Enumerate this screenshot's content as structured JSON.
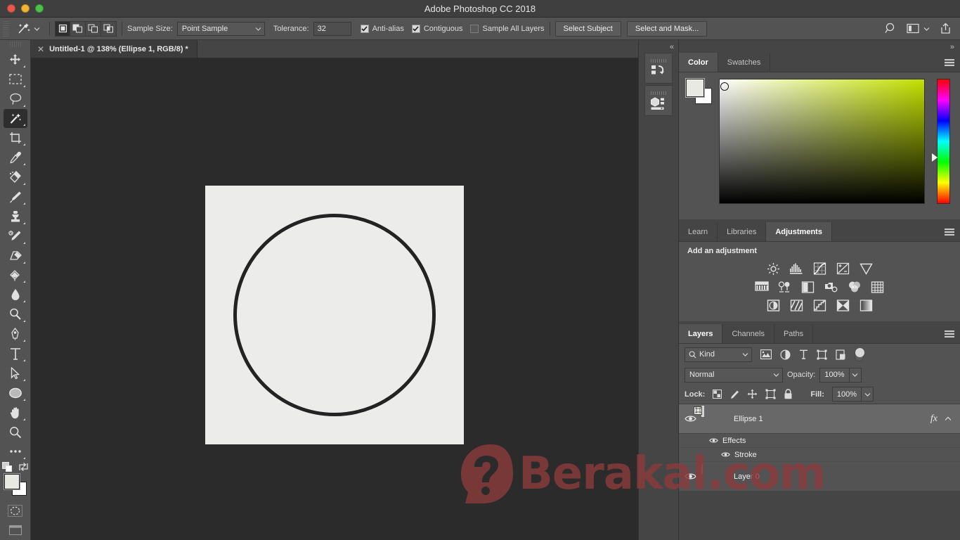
{
  "window": {
    "title": "Adobe Photoshop CC 2018",
    "controls": [
      "close",
      "minimize",
      "maximize"
    ]
  },
  "options_bar": {
    "tool_icon": "magic-wand-icon",
    "tool_preset_chevron": "chevron-down-icon",
    "selection_modes": [
      {
        "name": "new-selection",
        "active": true
      },
      {
        "name": "add-to-selection",
        "active": false
      },
      {
        "name": "subtract-from-selection",
        "active": false
      },
      {
        "name": "intersect-with-selection",
        "active": false
      }
    ],
    "sample_size_label": "Sample Size:",
    "sample_size_value": "Point Sample",
    "tolerance_label": "Tolerance:",
    "tolerance_value": "32",
    "anti_alias_label": "Anti-alias",
    "anti_alias_checked": true,
    "contiguous_label": "Contiguous",
    "contiguous_checked": true,
    "sample_all_layers_label": "Sample All Layers",
    "sample_all_layers_checked": false,
    "select_subject_label": "Select Subject",
    "select_and_mask_label": "Select and Mask...",
    "right_icons": [
      "search-icon",
      "workspace-icon",
      "chevron-down-icon",
      "share-icon"
    ]
  },
  "document_tab": {
    "close_icon": "close-icon",
    "title": "Untitled-1 @ 138% (Ellipse 1, RGB/8) *"
  },
  "toolbar": {
    "tools": [
      {
        "name": "move-tool",
        "active": false
      },
      {
        "name": "rectangular-marquee-tool",
        "active": false
      },
      {
        "name": "lasso-tool",
        "active": false
      },
      {
        "name": "magic-wand-tool",
        "active": true
      },
      {
        "name": "crop-tool",
        "active": false
      },
      {
        "name": "eyedropper-tool",
        "active": false
      },
      {
        "name": "spot-healing-brush-tool",
        "active": false
      },
      {
        "name": "brush-tool",
        "active": false
      },
      {
        "name": "clone-stamp-tool",
        "active": false
      },
      {
        "name": "history-brush-tool",
        "active": false
      },
      {
        "name": "eraser-tool",
        "active": false
      },
      {
        "name": "gradient-tool",
        "active": false
      },
      {
        "name": "blur-tool",
        "active": false
      },
      {
        "name": "dodge-tool",
        "active": false
      },
      {
        "name": "pen-tool",
        "active": false
      },
      {
        "name": "type-tool",
        "active": false
      },
      {
        "name": "path-selection-tool",
        "active": false
      },
      {
        "name": "ellipse-tool",
        "active": false
      },
      {
        "name": "hand-tool",
        "active": false
      },
      {
        "name": "zoom-tool",
        "active": false
      },
      {
        "name": "edit-toolbar-tool",
        "active": false
      }
    ],
    "foreground_color": "#e9e9e4",
    "background_color": "#ffffff",
    "quick_mask": "quick-mask-icon",
    "screen_mode": "screen-mode-icon"
  },
  "canvas": {
    "background_color": "#ececeb",
    "shape": "ellipse",
    "stroke_color": "#232323",
    "workspace_color": "#2b2b2b"
  },
  "mini_dock": {
    "collapse_icon": "double-chevron-left-icon",
    "items": [
      {
        "name": "history-panel-icon"
      },
      {
        "name": "properties-panel-icon"
      }
    ]
  },
  "color_panel": {
    "collapse_icon": "double-chevron-right-icon",
    "tabs": [
      {
        "label": "Color",
        "active": true
      },
      {
        "label": "Swatches",
        "active": false
      }
    ],
    "menu_icon": "panel-menu-icon",
    "foreground_color": "#e9e9e4",
    "background_color": "#ffffff",
    "ramp_color": "#c3e000"
  },
  "adjustments_panel": {
    "tabs": [
      {
        "label": "Learn",
        "active": false
      },
      {
        "label": "Libraries",
        "active": false
      },
      {
        "label": "Adjustments",
        "active": true
      }
    ],
    "menu_icon": "panel-menu-icon",
    "heading": "Add an adjustment",
    "rows": [
      [
        "brightness-contrast-icon",
        "levels-icon",
        "curves-icon",
        "exposure-icon",
        "vibrance-icon"
      ],
      [
        "hue-saturation-icon",
        "color-balance-icon",
        "black-and-white-icon",
        "photo-filter-icon",
        "channel-mixer-icon",
        "color-lookup-icon"
      ],
      [
        "invert-icon",
        "posterize-icon",
        "threshold-icon",
        "selective-color-icon",
        "gradient-map-icon"
      ]
    ]
  },
  "layers_panel": {
    "tabs": [
      {
        "label": "Layers",
        "active": true
      },
      {
        "label": "Channels",
        "active": false
      },
      {
        "label": "Paths",
        "active": false
      }
    ],
    "menu_icon": "panel-menu-icon",
    "filter_label": "Kind",
    "filter_search_icon": "search-icon",
    "filter_icons": [
      "filter-pixel-icon",
      "filter-adjustment-icon",
      "filter-type-icon",
      "filter-shape-icon",
      "filter-smart-object-icon"
    ],
    "filter_toggle": "filter-enable-toggle",
    "blend_mode": "Normal",
    "opacity_label": "Opacity:",
    "opacity_value": "100%",
    "lock_label": "Lock:",
    "lock_icons": [
      "lock-transparent-pixels-icon",
      "lock-image-pixels-icon",
      "lock-position-icon",
      "lock-artboard-nesting-icon",
      "lock-all-icon"
    ],
    "fill_label": "Fill:",
    "fill_value": "100%",
    "layers": [
      {
        "name": "Ellipse 1",
        "selected": true,
        "visible": true,
        "visibility_icon": "eye-icon",
        "thumbnail": "shape-layer-thumbnail",
        "fx_label": "fx",
        "expand_icon": "chevron-up-icon",
        "effects": [
          {
            "label": "Effects",
            "visible": true,
            "visibility_icon": "eye-icon"
          },
          {
            "label": "Stroke",
            "visible": true,
            "visibility_icon": "eye-icon"
          }
        ]
      },
      {
        "name": "Layer 0",
        "selected": false,
        "visible": true,
        "visibility_icon": "eye-icon",
        "thumbnail": "pixel-layer-thumbnail",
        "effects": []
      }
    ]
  },
  "watermark": {
    "text": "Berakal.com",
    "logo": "question-head-icon",
    "color": "#8b3b3c"
  }
}
